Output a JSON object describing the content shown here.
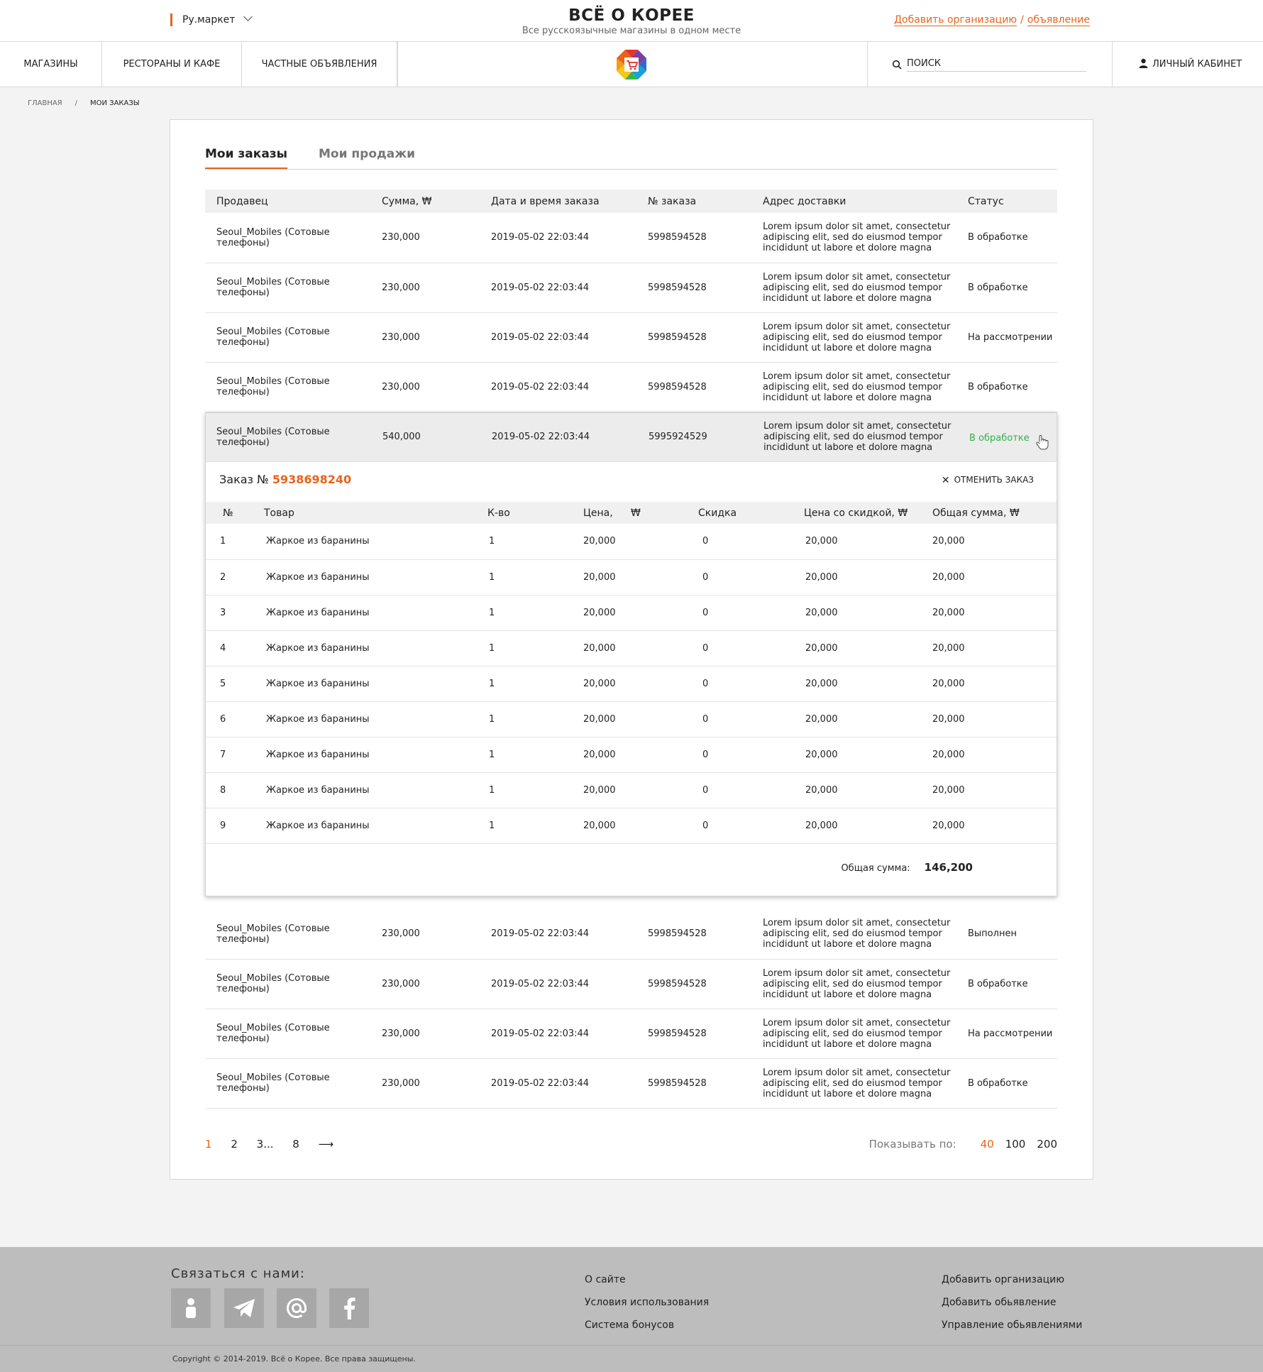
{
  "header": {
    "market": "Ру.маркет",
    "title": "ВСЁ О КОРЕЕ",
    "subtitle": "Все русскоязычные магазины в одном месте",
    "add_org": "Добавить организацию",
    "separator": "/",
    "add_ad": "объявление"
  },
  "nav": {
    "shops": "МАГАЗИНЫ",
    "restaurants": "РЕСТОРАНЫ И КАФЕ",
    "private_ads": "ЧАСТНЫЕ ОБЪЯВЛЕНИЯ",
    "search_placeholder": "ПОИСК",
    "cabinet": "ЛИЧНЫЙ КАБИНЕТ"
  },
  "breadcrumbs": [
    "ГЛАВНАЯ",
    "/",
    "МОИ ЗАКАЗЫ"
  ],
  "tabs": [
    {
      "label": "Мои заказы",
      "active": true
    },
    {
      "label": "Мои продажи",
      "active": false
    }
  ],
  "orders": {
    "columns": [
      "Продавец",
      "Сумма, ₩",
      "Дата и время заказа",
      "№ заказа",
      "Адрес доставки",
      "Статус"
    ],
    "rows_top": [
      {
        "seller": "Seoul_Mobiles (Сотовые телефоны)",
        "sum": "230,000",
        "date": "2019-05-02 22:03:44",
        "num": "5998594528",
        "address": "Lorem ipsum dolor sit amet, consectetur adipiscing elit, sed do eiusmod tempor incididunt ut labore et dolore magna",
        "status": "В обработке",
        "status_type": "green"
      },
      {
        "seller": "Seoul_Mobiles (Сотовые телефоны)",
        "sum": "230,000",
        "date": "2019-05-02 22:03:44",
        "num": "5998594528",
        "address": "Lorem ipsum dolor sit amet, consectetur adipiscing elit, sed do eiusmod tempor incididunt ut labore et dolore magna",
        "status": "В обработке",
        "status_type": "green"
      },
      {
        "seller": "Seoul_Mobiles (Сотовые телефоны)",
        "sum": "230,000",
        "date": "2019-05-02 22:03:44",
        "num": "5998594528",
        "address": "Lorem ipsum dolor sit amet, consectetur adipiscing elit, sed do eiusmod tempor incididunt ut labore et dolore magna",
        "status": "На рассмотрении",
        "status_type": "blue"
      },
      {
        "seller": "Seoul_Mobiles (Сотовые телефоны)",
        "sum": "230,000",
        "date": "2019-05-02 22:03:44",
        "num": "5998594528",
        "address": "Lorem ipsum dolor sit amet, consectetur adipiscing elit, sed do eiusmod tempor incididunt ut labore et dolore magna",
        "status": "В обработке",
        "status_type": "green"
      }
    ],
    "expanded_row": {
      "seller": "Seoul_Mobiles (Сотовые телефоны)",
      "sum": "540,000",
      "date": "2019-05-02 22:03:44",
      "num": "5995924529",
      "address": "Lorem ipsum dolor sit amet, consectetur adipiscing elit, sed do eiusmod tempor incididunt ut labore et dolore magna",
      "status": "В обработке",
      "status_type": "green"
    },
    "rows_bottom": [
      {
        "seller": "Seoul_Mobiles (Сотовые телефоны)",
        "sum": "230,000",
        "date": "2019-05-02 22:03:44",
        "num": "5998594528",
        "address": "Lorem ipsum dolor sit amet, consectetur adipiscing elit, sed do eiusmod tempor incididunt ut labore et dolore magna",
        "status": "Выполнен",
        "status_type": "dark"
      },
      {
        "seller": "Seoul_Mobiles (Сотовые телефоны)",
        "sum": "230,000",
        "date": "2019-05-02 22:03:44",
        "num": "5998594528",
        "address": "Lorem ipsum dolor sit amet, consectetur adipiscing elit, sed do eiusmod tempor incididunt ut labore et dolore magna",
        "status": "В обработке",
        "status_type": "green"
      },
      {
        "seller": "Seoul_Mobiles (Сотовые телефоны)",
        "sum": "230,000",
        "date": "2019-05-02 22:03:44",
        "num": "5998594528",
        "address": "Lorem ipsum dolor sit amet, consectetur adipiscing elit, sed do eiusmod tempor incididunt ut labore et dolore magna",
        "status": "На рассмотрении",
        "status_type": "blue"
      },
      {
        "seller": "Seoul_Mobiles (Сотовые телефоны)",
        "sum": "230,000",
        "date": "2019-05-02 22:03:44",
        "num": "5998594528",
        "address": "Lorem ipsum dolor sit amet, consectetur adipiscing elit, sed do eiusmod tempor incididunt ut labore et dolore magna",
        "status": "В обработке",
        "status_type": "green"
      }
    ]
  },
  "order_detail": {
    "label": "Заказ №",
    "number": "5938698240",
    "cancel": "ОТМЕНИТЬ ЗАКАЗ",
    "columns": [
      "№",
      "Товар",
      "К-во",
      "Цена,",
      "₩",
      "Скидка",
      "Цена со скидкой, ₩",
      "Общая сумма, ₩"
    ],
    "items": [
      {
        "n": "1",
        "name": "Жаркое из баранины",
        "qty": "1",
        "price": "20,000",
        "discount": "0",
        "discounted": "20,000",
        "total": "20,000"
      },
      {
        "n": "2",
        "name": "Жаркое из баранины",
        "qty": "1",
        "price": "20,000",
        "discount": "0",
        "discounted": "20,000",
        "total": "20,000"
      },
      {
        "n": "3",
        "name": "Жаркое из баранины",
        "qty": "1",
        "price": "20,000",
        "discount": "0",
        "discounted": "20,000",
        "total": "20,000"
      },
      {
        "n": "4",
        "name": "Жаркое из баранины",
        "qty": "1",
        "price": "20,000",
        "discount": "0",
        "discounted": "20,000",
        "total": "20,000"
      },
      {
        "n": "5",
        "name": "Жаркое из баранины",
        "qty": "1",
        "price": "20,000",
        "discount": "0",
        "discounted": "20,000",
        "total": "20,000"
      },
      {
        "n": "6",
        "name": "Жаркое из баранины",
        "qty": "1",
        "price": "20,000",
        "discount": "0",
        "discounted": "20,000",
        "total": "20,000"
      },
      {
        "n": "7",
        "name": "Жаркое из баранины",
        "qty": "1",
        "price": "20,000",
        "discount": "0",
        "discounted": "20,000",
        "total": "20,000"
      },
      {
        "n": "8",
        "name": "Жаркое из баранины",
        "qty": "1",
        "price": "20,000",
        "discount": "0",
        "discounted": "20,000",
        "total": "20,000"
      },
      {
        "n": "9",
        "name": "Жаркое из баранины",
        "qty": "1",
        "price": "20,000",
        "discount": "0",
        "discounted": "20,000",
        "total": "20,000"
      }
    ],
    "total_label": "Общая сумма:",
    "total_value": "146,200"
  },
  "pagination": {
    "pages": [
      "1",
      "2",
      "3...",
      "8"
    ],
    "current": "1",
    "next": "⟶",
    "per_page_label": "Показывать по:",
    "per_page": [
      "40",
      "100",
      "200"
    ],
    "per_page_current": "40"
  },
  "footer": {
    "contact": "Связаться с нами:",
    "social_icons": [
      "person-icon",
      "telegram-icon",
      "at-icon",
      "facebook-icon"
    ],
    "col1": [
      "О сайте",
      "Условия использования",
      "Система бонусов"
    ],
    "col2": [
      "Добавить организацию",
      "Добавить обьявление",
      "Управление обьявлениями"
    ],
    "copyright": "Copyright © 2014-2019. Всё о Корее. Все права защищены."
  },
  "colors": {
    "accent": "#e8641b",
    "status_green": "#2db34a",
    "status_blue": "#1f6fbf"
  }
}
